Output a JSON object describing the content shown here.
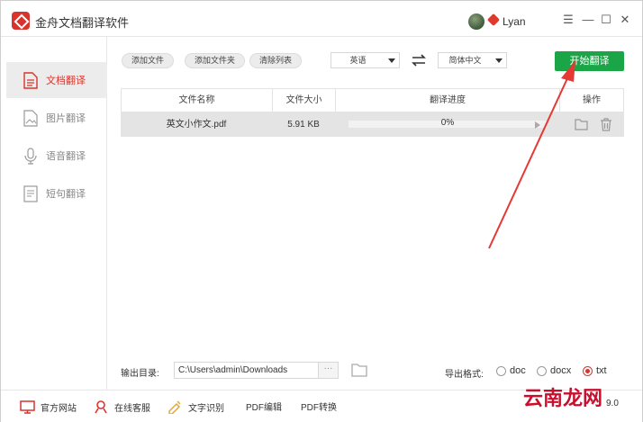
{
  "app": {
    "title": "金舟文档翻译软件",
    "user_name": "Lyan",
    "minimize_label": "—",
    "maximize_label": "☐",
    "close_label": "✕",
    "menu_label": "☰"
  },
  "sidebar": {
    "items": [
      {
        "label": "文档翻译",
        "icon": "document-icon",
        "active": true
      },
      {
        "label": "图片翻译",
        "icon": "image-icon",
        "active": false
      },
      {
        "label": "语音翻译",
        "icon": "microphone-icon",
        "active": false
      },
      {
        "label": "短句翻译",
        "icon": "text-icon",
        "active": false
      }
    ]
  },
  "toolbar": {
    "add_file": "添加文件",
    "add_folder": "添加文件夹",
    "clear_list": "清除列表",
    "source_lang": "英语",
    "target_lang": "简体中文",
    "start": "开始翻译"
  },
  "table": {
    "headers": [
      "文件名称",
      "文件大小",
      "翻译进度",
      "操作"
    ],
    "rows": [
      {
        "name": "英文小作文.pdf",
        "size": "5.91 KB",
        "progress_text": "0%",
        "progress": 0
      }
    ]
  },
  "output": {
    "label": "输出目录:",
    "path": "C:\\Users\\admin\\Downloads",
    "browse": "···",
    "format_label": "导出格式:",
    "formats": [
      {
        "label": "doc",
        "checked": false
      },
      {
        "label": "docx",
        "checked": false
      },
      {
        "label": "txt",
        "checked": true
      }
    ]
  },
  "footer": {
    "items": [
      {
        "label": "官方网站",
        "icon": "monitor-icon"
      },
      {
        "label": "在线客服",
        "icon": "support-icon"
      },
      {
        "label": "文字识别",
        "icon": "ocr-icon"
      },
      {
        "label": "PDF编辑",
        "icon": ""
      },
      {
        "label": "PDF转换",
        "icon": ""
      }
    ],
    "watermark": "云南龙网",
    "version": "9.0"
  },
  "colors": {
    "accent_red": "#d9342b",
    "start_green": "#1aa547",
    "arrow_red": "#e53935"
  }
}
